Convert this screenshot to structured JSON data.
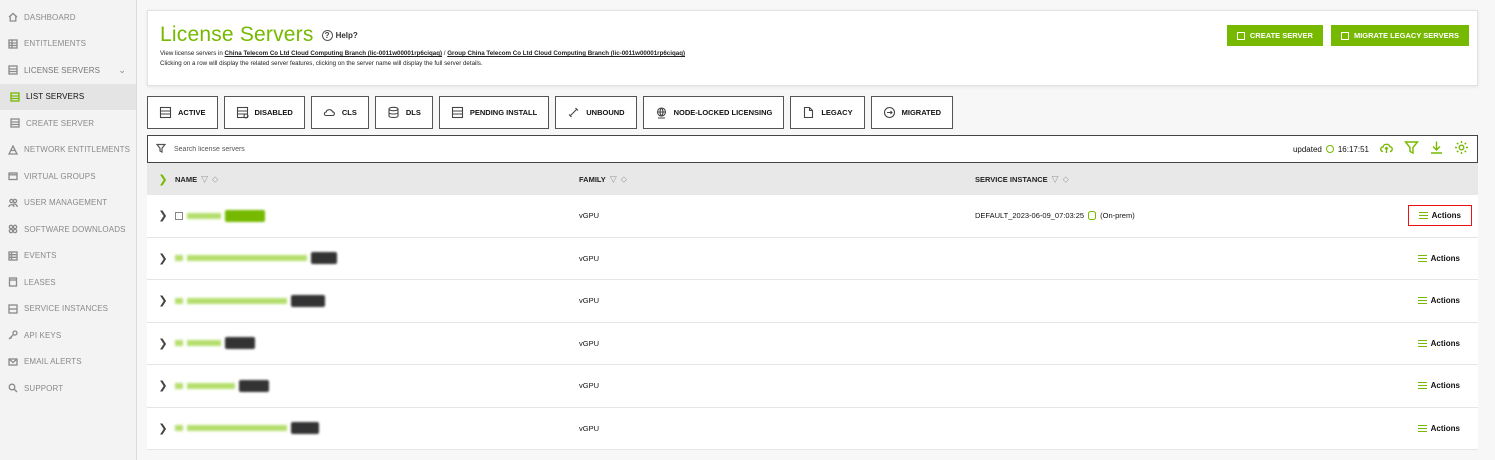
{
  "sidebar": {
    "items": [
      {
        "label": "DASHBOARD",
        "icon": "home-icon"
      },
      {
        "label": "ENTITLEMENTS",
        "icon": "grid-icon"
      },
      {
        "label": "LICENSE SERVERS",
        "icon": "server-icon",
        "expanded": true
      },
      {
        "label": "LIST SERVERS",
        "icon": "list-icon",
        "active": true,
        "sub": true
      },
      {
        "label": "CREATE SERVER",
        "icon": "server-plus-icon",
        "sub": true
      },
      {
        "label": "NETWORK ENTITLEMENTS",
        "icon": "network-icon"
      },
      {
        "label": "VIRTUAL GROUPS",
        "icon": "folder-icon"
      },
      {
        "label": "USER MANAGEMENT",
        "icon": "users-icon"
      },
      {
        "label": "SOFTWARE DOWNLOADS",
        "icon": "download-icon"
      },
      {
        "label": "EVENTS",
        "icon": "events-icon"
      },
      {
        "label": "LEASES",
        "icon": "lease-icon"
      },
      {
        "label": "SERVICE INSTANCES",
        "icon": "instance-icon"
      },
      {
        "label": "API KEYS",
        "icon": "key-icon"
      },
      {
        "label": "EMAIL ALERTS",
        "icon": "mail-icon"
      },
      {
        "label": "SUPPORT",
        "icon": "support-icon"
      }
    ]
  },
  "header": {
    "title": "License Servers",
    "help_label": "Help?",
    "desc_prefix": "View license servers in ",
    "org_link": "China Telecom Co Ltd Cloud Computing Branch (lic-0011w00001rp6ciqaq)",
    "separator": " / ",
    "group_link": "Group China Telecom Co Ltd Cloud Computing Branch (lic-0011w00001rp6ciqaq)",
    "desc_line2": "Clicking on a row will display the related server features, clicking on the server name will display the full server details.",
    "create_label": "CREATE SERVER",
    "migrate_label": "MIGRATE LEGACY SERVERS"
  },
  "filter_tabs": [
    {
      "label": "ACTIVE",
      "icon": "active-server-icon"
    },
    {
      "label": "DISABLED",
      "icon": "disabled-server-icon"
    },
    {
      "label": "CLS",
      "icon": "cloud-icon"
    },
    {
      "label": "DLS",
      "icon": "database-icon"
    },
    {
      "label": "PENDING INSTALL",
      "icon": "pending-install-icon"
    },
    {
      "label": "UNBOUND",
      "icon": "link-icon"
    },
    {
      "label": "NODE-LOCKED LICENSING",
      "icon": "globe-icon"
    },
    {
      "label": "LEGACY",
      "icon": "legacy-icon"
    },
    {
      "label": "MIGRATED",
      "icon": "migrated-icon"
    }
  ],
  "search": {
    "placeholder": "Search license servers",
    "updated_label": "updated",
    "updated_time": "16:17:51"
  },
  "table": {
    "columns": [
      "NAME",
      "FAMILY",
      "SERVICE INSTANCE"
    ],
    "rows": [
      {
        "family": "vGPU",
        "service_instance": "DEFAULT_2023-06-09_07:03:25",
        "instance_type": "(On-prem)",
        "badge": "green",
        "actions": "Actions",
        "highlight": true
      },
      {
        "family": "vGPU",
        "service_instance": "",
        "instance_type": "",
        "badge": "dark",
        "actions": "Actions"
      },
      {
        "family": "vGPU",
        "service_instance": "",
        "instance_type": "",
        "badge": "dark",
        "actions": "Actions"
      },
      {
        "family": "vGPU",
        "service_instance": "",
        "instance_type": "",
        "badge": "dark",
        "actions": "Actions"
      },
      {
        "family": "vGPU",
        "service_instance": "",
        "instance_type": "",
        "badge": "dark",
        "actions": "Actions"
      },
      {
        "family": "vGPU",
        "service_instance": "",
        "instance_type": "",
        "badge": "dark",
        "actions": "Actions"
      }
    ]
  },
  "colors": {
    "accent": "#76b900",
    "highlight": "#e11111"
  }
}
